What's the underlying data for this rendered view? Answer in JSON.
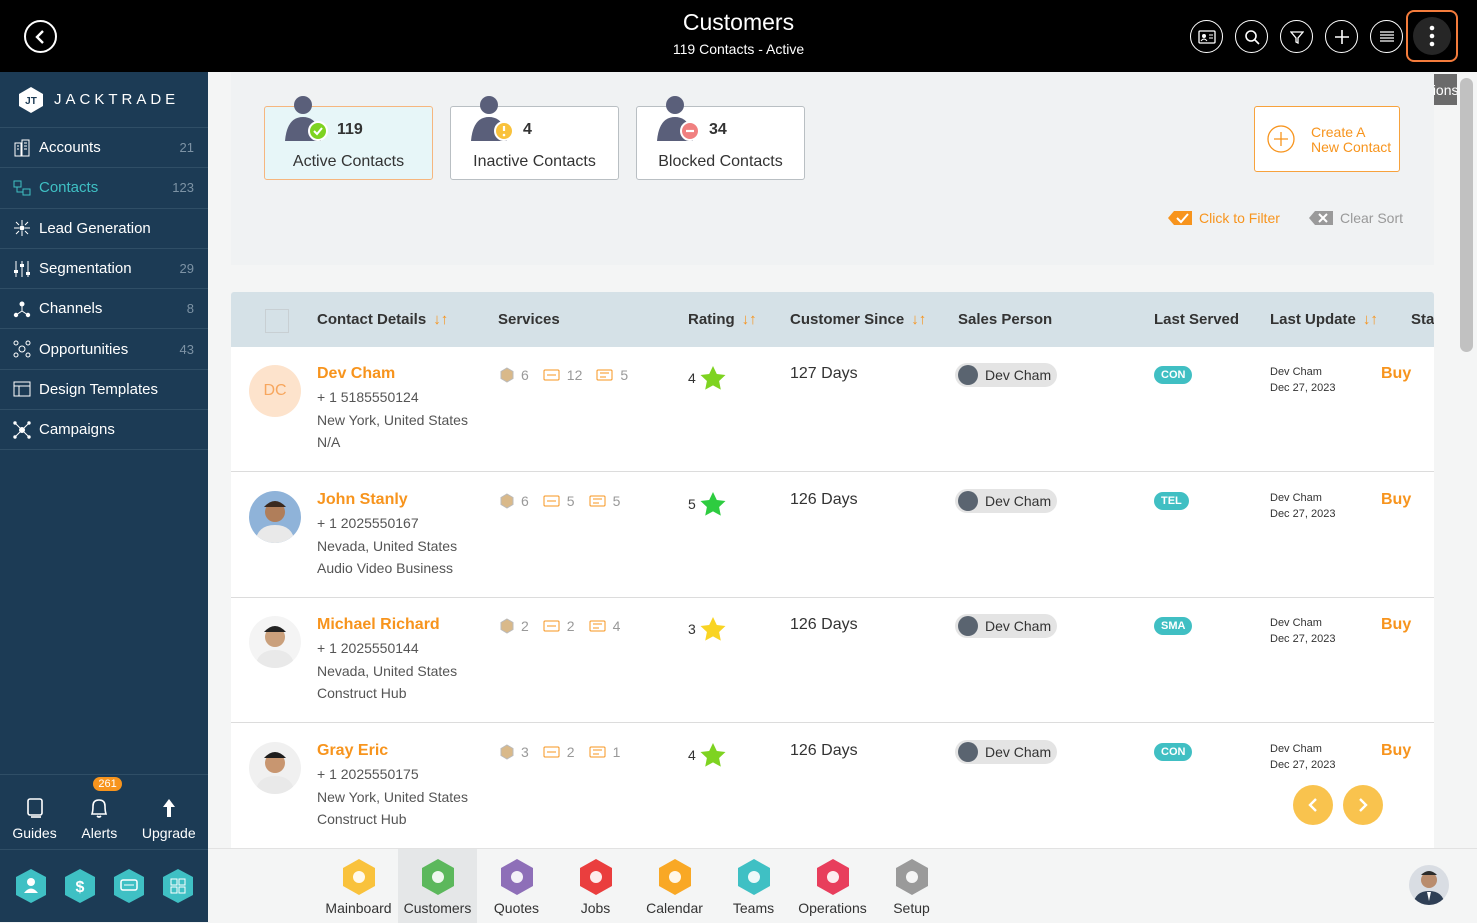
{
  "header": {
    "title": "Customers",
    "subtitle": "119 Contacts - Active",
    "tooltip": "More Options"
  },
  "brand": {
    "name": "JACKTRADE"
  },
  "sidebar": {
    "items": [
      {
        "label": "Accounts",
        "count": "21"
      },
      {
        "label": "Contacts",
        "count": "123"
      },
      {
        "label": "Lead Generation",
        "count": ""
      },
      {
        "label": "Segmentation",
        "count": "29"
      },
      {
        "label": "Channels",
        "count": "8"
      },
      {
        "label": "Opportunities",
        "count": "43"
      },
      {
        "label": "Design Templates",
        "count": ""
      },
      {
        "label": "Campaigns",
        "count": ""
      }
    ],
    "bottom": [
      {
        "label": "Guides"
      },
      {
        "label": "Alerts",
        "badge": "261"
      },
      {
        "label": "Upgrade"
      }
    ]
  },
  "stats": [
    {
      "count": "119",
      "label": "Active Contacts"
    },
    {
      "count": "4",
      "label": "Inactive Contacts"
    },
    {
      "count": "34",
      "label": "Blocked Contacts"
    }
  ],
  "create": {
    "line1": "Create A",
    "line2": "New Contact"
  },
  "filters": {
    "click_to_filter": "Click to Filter",
    "clear_sort": "Clear Sort"
  },
  "table": {
    "columns": [
      "Contact Details",
      "Services",
      "Rating",
      "Customer Since",
      "Sales Person",
      "Last Served",
      "Last Update",
      "Stat"
    ],
    "rows": [
      {
        "initials": "DC",
        "name": "Dev Cham",
        "phone": "+ 1 5185550124",
        "location": "New York, United States",
        "company": "N/A",
        "s1": "6",
        "s2": "12",
        "s3": "5",
        "rating": "4",
        "star_color": "#7ed321",
        "since": "127 Days",
        "sales": "Dev Cham",
        "served": "CON",
        "upd_by": "Dev Cham",
        "upd_date": "Dec 27, 2023",
        "status": "Buy"
      },
      {
        "initials": "",
        "name": "John Stanly",
        "phone": "+ 1 2025550167",
        "location": "Nevada, United States",
        "company": "Audio Video Business",
        "s1": "6",
        "s2": "5",
        "s3": "5",
        "rating": "5",
        "star_color": "#2ecc40",
        "since": "126 Days",
        "sales": "Dev Cham",
        "served": "TEL",
        "upd_by": "Dev Cham",
        "upd_date": "Dec 27, 2023",
        "status": "Buy"
      },
      {
        "initials": "",
        "name": "Michael Richard",
        "phone": "+ 1 2025550144",
        "location": "Nevada, United States",
        "company": "Construct Hub",
        "s1": "2",
        "s2": "2",
        "s3": "4",
        "rating": "3",
        "star_color": "#f9d423",
        "since": "126 Days",
        "sales": "Dev Cham",
        "served": "SMA",
        "upd_by": "Dev Cham",
        "upd_date": "Dec 27, 2023",
        "status": "Buy"
      },
      {
        "initials": "",
        "name": "Gray Eric",
        "phone": "+ 1 2025550175",
        "location": "New York, United States",
        "company": "Construct Hub",
        "s1": "3",
        "s2": "2",
        "s3": "1",
        "rating": "4",
        "star_color": "#7ed321",
        "since": "126 Days",
        "sales": "Dev Cham",
        "served": "CON",
        "upd_by": "Dev Cham",
        "upd_date": "Dec 27, 2023",
        "status": "Buy"
      }
    ]
  },
  "bottom_nav": [
    {
      "label": "Mainboard",
      "color": "#f9c23c"
    },
    {
      "label": "Customers",
      "color": "#5cb85c"
    },
    {
      "label": "Quotes",
      "color": "#8e6fb8"
    },
    {
      "label": "Jobs",
      "color": "#ea3e3e"
    },
    {
      "label": "Calendar",
      "color": "#f9a825"
    },
    {
      "label": "Teams",
      "color": "#3fc0c4"
    },
    {
      "label": "Operations",
      "color": "#e83e5c"
    },
    {
      "label": "Setup",
      "color": "#9a9a9a"
    }
  ],
  "colors": {
    "accent": "#f7941d",
    "sidebar": "#1c3b55",
    "teal": "#40bfc3"
  }
}
